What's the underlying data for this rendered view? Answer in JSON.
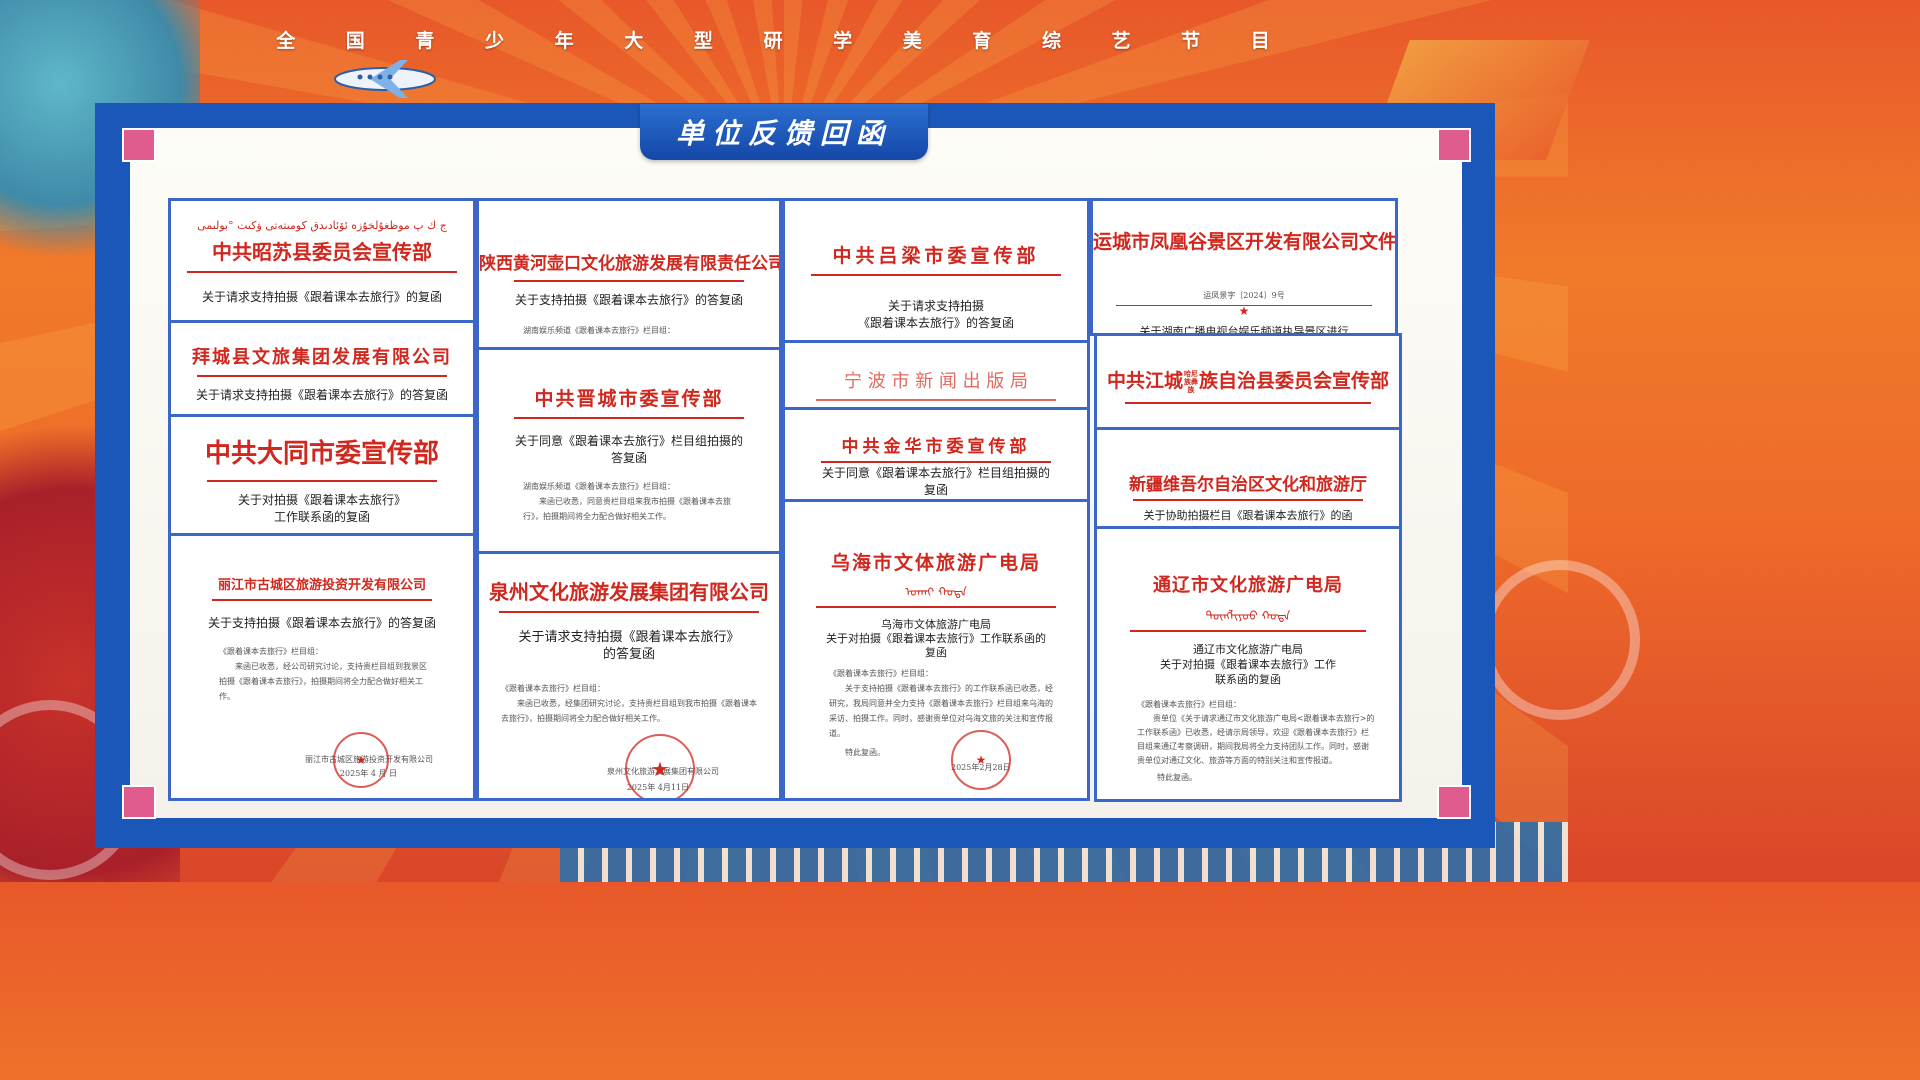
{
  "program_title": "全 国 青 少 年 大 型 研 学 美 育 综 艺 节 目",
  "section_title": "单位反馈回函",
  "colors": {
    "frame_blue": "#1b57b8",
    "banner_blue": "#2b6fd0",
    "corner_pink": "#e05b8e",
    "document_red": "#d0281e"
  },
  "letters": {
    "zhaosu": {
      "script": "ج ك پ موظغۇلخۇزه ئۆئادىدق كومىتەتى ۋكىت °بولىمى",
      "org": "中共昭苏县委员会宣传部",
      "subject": "关于请求支持拍摄《跟着课本去旅行》的复函"
    },
    "baicheng": {
      "org": "拜城县文旅集团发展有限公司",
      "subject": "关于请求支持拍摄《跟着课本去旅行》的答复函"
    },
    "datong": {
      "org": "中共大同市委宣传部",
      "subject_1": "关于对拍摄《跟着课本去旅行》",
      "subject_2": "工作联系函的复函"
    },
    "lijiang": {
      "org": "丽江市古城区旅游投资开发有限公司",
      "subject": "关于支持拍摄《跟着课本去旅行》的答复函",
      "salutation": "《跟着课本去旅行》栏目组：",
      "body": "来函已收悉，经公司研究讨论，支持贵栏目组到我景区拍摄《跟着课本去旅行》，拍摄期间将全力配合做好相关工作。",
      "signature": "丽江市古城区旅游投资开发有限公司",
      "date": "2025年 4 月 日"
    },
    "hukou": {
      "org": "陕西黄河壶口文化旅游发展有限责任公司",
      "subject": "关于支持拍摄《跟着课本去旅行》的答复函",
      "line": "湖南娱乐频道《跟着课本去旅行》栏目组："
    },
    "jincheng": {
      "org": "中共晋城市委宣传部",
      "subject_1": "关于同意《跟着课本去旅行》栏目组拍摄的",
      "subject_2": "答复函",
      "salutation": "湖南娱乐频道《跟着课本去旅行》栏目组：",
      "body": "来函已收悉，同意贵栏目组来我市拍摄《跟着课本去旅行》，拍摄期间将全力配合做好相关工作。"
    },
    "quanzhou": {
      "org": "泉州文化旅游发展集团有限公司",
      "subject_1": "关于请求支持拍摄《跟着课本去旅行》",
      "subject_2": "的答复函",
      "salutation": "《跟着课本去旅行》栏目组：",
      "body": "来函已收悉，经集团研究讨论，支持贵栏目组到我市拍摄《跟着课本去旅行》，拍摄期间将全力配合做好相关工作。",
      "signature": "泉州文化旅游发展集团有限公司",
      "date": "2025年 4月11日"
    },
    "lvliang": {
      "org": "中共吕梁市委宣传部",
      "subject_1": "关于请求支持拍摄",
      "subject_2": "《跟着课本去旅行》的答复函"
    },
    "ningbo": {
      "org": "宁 波 市 新 闻 出 版 局"
    },
    "jinhua": {
      "org": "中共金华市委宣传部",
      "subject_1": "关于同意《跟着课本去旅行》栏目组拍摄的",
      "subject_2": "复函"
    },
    "wuhai": {
      "org": "乌海市文体旅游广电局",
      "script": "ᠤᠬᠠᠢ ᠬᠣᠲᠠ",
      "subject_1": "乌海市文体旅游广电局",
      "subject_2": "关于对拍摄《跟着课本去旅行》工作联系函的",
      "subject_3": "复函",
      "salutation": "《跟着课本去旅行》栏目组：",
      "body": "关于支持拍摄《跟着课本去旅行》的工作联系函已收悉，经研究，我局同意并全力支持《跟着课本去旅行》栏目组来乌海的采访、拍摄工作。同时，感谢贵单位对乌海文旅的关注和宣传报道。",
      "closing": "特此复函。",
      "date": "2025年2月28日"
    },
    "yuncheng": {
      "org": "运城市凤凰谷景区开发有限公司文件",
      "doc_no": "运凤景字〔2024〕9号",
      "line": "关于湖南广播电视台娱乐频道执导景区进行"
    },
    "jiangcheng": {
      "org_1": "中共江城",
      "org_small": "哈尼族彝族",
      "org_2": "族自治县委员会宣传部"
    },
    "xinjiang": {
      "org": "新疆维吾尔自治区文化和旅游厅",
      "subject": "关于协助拍摄栏目《跟着课本去旅行》的函"
    },
    "tongliao": {
      "org": "通辽市文化旅游广电局",
      "script": "ᠲᠦᠩᠯᠢᠶᠣᠤ ᠬᠣᠲᠠ",
      "subject_1": "通辽市文化旅游广电局",
      "subject_2": "关于对拍摄《跟着课本去旅行》工作",
      "subject_3": "联系函的复函",
      "salutation": "《跟着课本去旅行》栏目组：",
      "body": "贵单位《关于请求通辽市文化旅游广电局<跟着课本去旅行>的工作联系函》已收悉，经请示局领导，欢迎《跟着课本去旅行》栏目组来通辽考察调研，期间我局将全力支持团队工作。同时，感谢贵单位对通辽文化、旅游等方面的特别关注和宣传报道。",
      "closing": "特此复函。"
    }
  }
}
